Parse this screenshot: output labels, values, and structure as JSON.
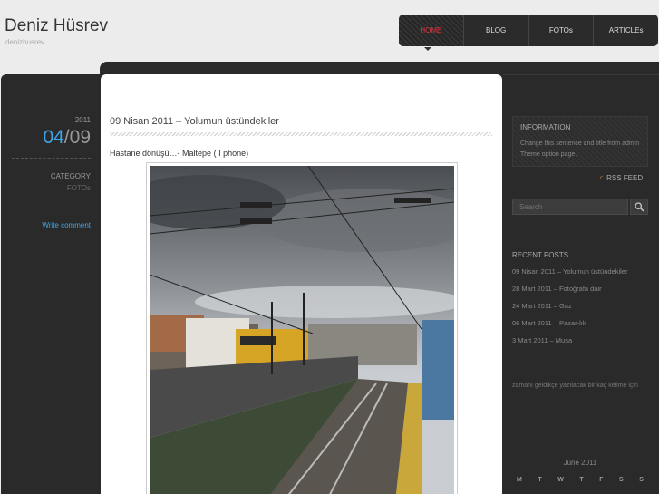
{
  "site": {
    "title": "Deniz Hüsrev",
    "description": "denizhusrev"
  },
  "nav": {
    "items": [
      {
        "label": "HOME"
      },
      {
        "label": "BLOG"
      },
      {
        "label": "FOTOs"
      },
      {
        "label": "ARTICLEs"
      }
    ]
  },
  "post": {
    "year": "2011",
    "day": "04",
    "month": "09",
    "category_label": "CATEGORY",
    "category_value": "FOTOs",
    "write_comment": "Write comment",
    "title": "09 Nisan 2011 – Yolumun üstündekiler",
    "text": "Hastane dönüşü…- Maltepe ( I phone)"
  },
  "sidebar": {
    "info_title": "INFORMATION",
    "info_text": "Change this sentence and title from admin Theme option page.",
    "rss_label": "RSS FEED",
    "search_placeholder": "Search",
    "recent_title": "RECENT POSTS",
    "recent_posts": [
      "09 Nisan 2011 – Yolumun üstündekiler",
      "28 Mart 2011 – Fotoğrafa dair",
      "24 Mart 2011 – Gaz",
      "06 Mart 2011 – Pazar-lık",
      "3 Mart 2011 – Musa"
    ],
    "text_widget": "zamanı geldikçe yazılacak bir kaç kelime için",
    "calendar_caption": "June 2011",
    "calendar_days": [
      "M",
      "T",
      "W",
      "T",
      "F",
      "S",
      "S"
    ]
  },
  "colors": {
    "accent": "#3fa5e6",
    "nav_active": "#e4323a",
    "rss": "#d59a2a"
  }
}
